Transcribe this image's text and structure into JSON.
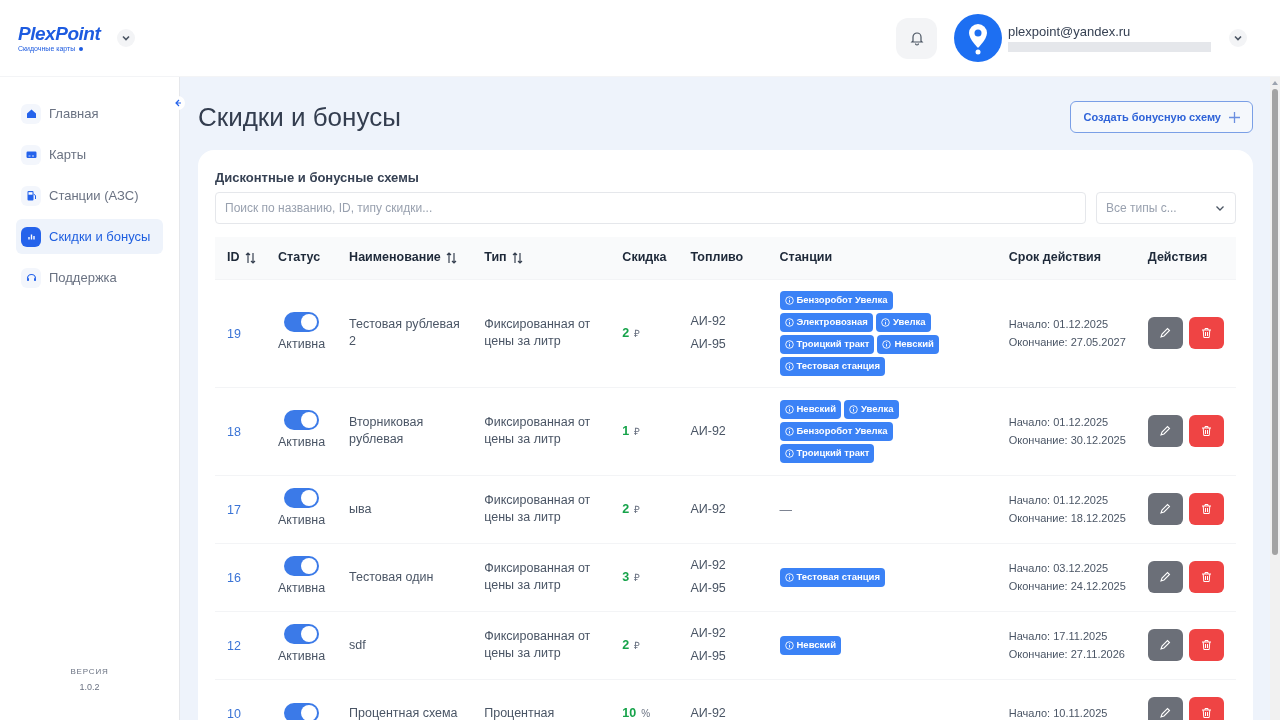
{
  "logo": {
    "name": "PlexPoint",
    "tagline": "Скидочные карты"
  },
  "header": {
    "user_email": "plexpoint@yandex.ru"
  },
  "sidebar": {
    "items": [
      {
        "label": "Главная",
        "selected": false
      },
      {
        "label": "Карты",
        "selected": false
      },
      {
        "label": "Станции (АЗС)",
        "selected": false
      },
      {
        "label": "Скидки и бонусы",
        "selected": true
      },
      {
        "label": "Поддержка",
        "selected": false
      }
    ],
    "version_label": "ВЕРСИЯ",
    "version": "1.0.2"
  },
  "page": {
    "title": "Скидки и бонусы",
    "create_button": "Создать бонусную схему"
  },
  "card": {
    "title": "Дисконтные и бонусные схемы",
    "search": {
      "placeholder": "Поиск по названию, ID, типу скидки..."
    },
    "type_filter": {
      "value": "Все типы с..."
    }
  },
  "table": {
    "columns": [
      {
        "label": "ID",
        "sortable": true
      },
      {
        "label": "Статус",
        "sortable": false
      },
      {
        "label": "Наименование",
        "sortable": true
      },
      {
        "label": "Тип",
        "sortable": true
      },
      {
        "label": "Скидка",
        "sortable": false
      },
      {
        "label": "Топливо",
        "sortable": false
      },
      {
        "label": "Станции",
        "sortable": false
      },
      {
        "label": "Срок действия",
        "sortable": false
      },
      {
        "label": "Действия",
        "sortable": false
      }
    ],
    "rows": [
      {
        "id": "19",
        "on": true,
        "status": "Активна",
        "name": "Тестовая рублевая 2",
        "type": "Фиксированная от цены за литр",
        "discount": "2",
        "unit": "₽",
        "fuel": [
          "АИ-92",
          "АИ-95"
        ],
        "stations": [
          "Бензоробот Увелка",
          "Электровозная",
          "Увелка",
          "Троицкий тракт",
          "Невский",
          "Тестовая станция"
        ],
        "start": "Начало: 01.12.2025",
        "end": "Окончание: 27.05.2027"
      },
      {
        "id": "18",
        "on": true,
        "status": "Активна",
        "name": "Вторниковая рублевая",
        "type": "Фиксированная от цены за литр",
        "discount": "1",
        "unit": "₽",
        "fuel": [
          "АИ-92"
        ],
        "stations": [
          "Невский",
          "Увелка",
          "Бензоробот Увелка",
          "Троицкий тракт"
        ],
        "start": "Начало: 01.12.2025",
        "end": "Окончание: 30.12.2025"
      },
      {
        "id": "17",
        "on": true,
        "status": "Активна",
        "name": "ыва",
        "type": "Фиксированная от цены за литр",
        "discount": "2",
        "unit": "₽",
        "fuel": [
          "АИ-92"
        ],
        "stations_empty": "—",
        "start": "Начало: 01.12.2025",
        "end": "Окончание: 18.12.2025"
      },
      {
        "id": "16",
        "on": true,
        "status": "Активна",
        "name": "Тестовая один",
        "type": "Фиксированная от цены за литр",
        "discount": "3",
        "unit": "₽",
        "fuel": [
          "АИ-92",
          "АИ-95"
        ],
        "stations": [
          "Тестовая станция"
        ],
        "start": "Начало: 03.12.2025",
        "end": "Окончание: 24.12.2025"
      },
      {
        "id": "12",
        "on": true,
        "status": "Активна",
        "name": "sdf",
        "type": "Фиксированная от цены за литр",
        "discount": "2",
        "unit": "₽",
        "fuel": [
          "АИ-92",
          "АИ-95"
        ],
        "stations": [
          "Невский"
        ],
        "start": "Начало: 17.11.2025",
        "end": "Окончание: 27.11.2026"
      },
      {
        "id": "10",
        "on": true,
        "name": "Процентная схема",
        "type": "Процентная",
        "discount": "10",
        "unit": "%",
        "fuel": [
          "АИ-92"
        ],
        "start": "Начало: 10.11.2025"
      }
    ]
  }
}
